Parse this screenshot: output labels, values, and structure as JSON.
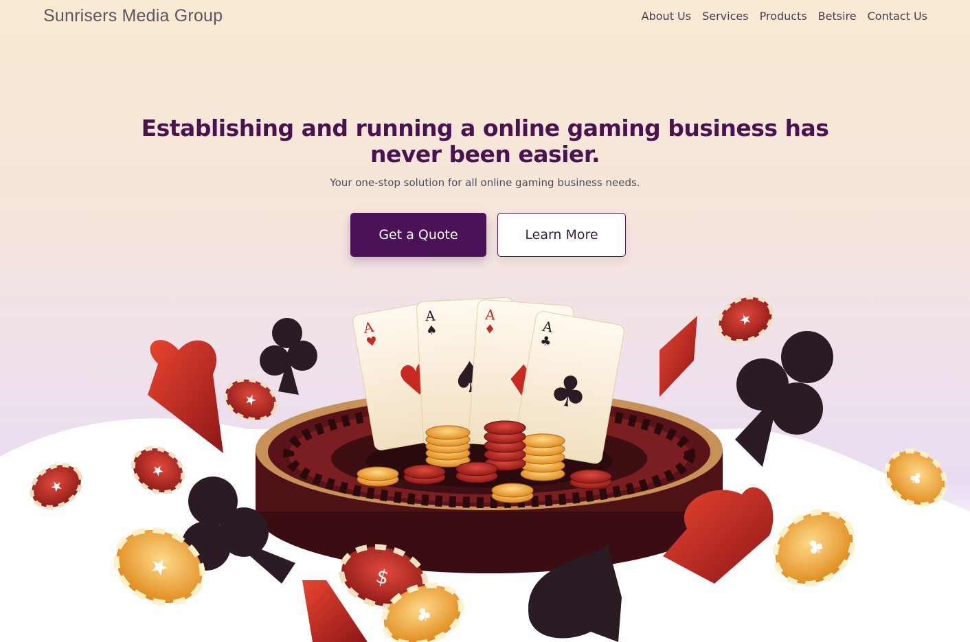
{
  "header": {
    "brand": "Sunrisers Media Group",
    "nav": [
      "About Us",
      "Services",
      "Products",
      "Betsire",
      "Contact Us"
    ]
  },
  "hero": {
    "title_line1": "Establishing and running a online gaming business has",
    "title_line2": "never been easier.",
    "subtitle": "Your one-stop solution for all online gaming business needs.",
    "primary_button": "Get a Quote",
    "secondary_button": "Learn More"
  },
  "illustration": {
    "cards": [
      {
        "rank": "A",
        "suit": "♥"
      },
      {
        "rank": "A",
        "suit": "♠"
      },
      {
        "rank": "A",
        "suit": "♦"
      },
      {
        "rank": "A",
        "suit": "♣"
      }
    ]
  },
  "colors": {
    "accent": "#4a1357",
    "title": "#4a1350",
    "red": "#b52a25",
    "dark": "#2b1b24",
    "gold": "#f0a93a"
  }
}
